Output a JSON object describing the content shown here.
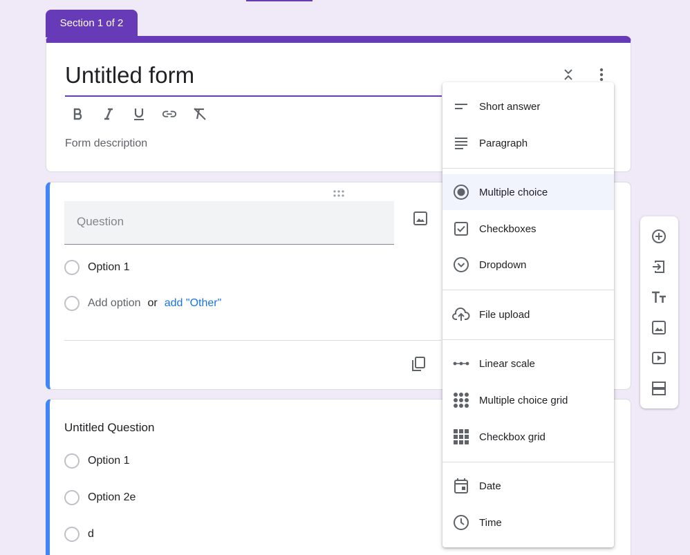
{
  "section_tab": "Section 1 of 2",
  "form": {
    "title": "Untitled form",
    "description_placeholder": "Form description"
  },
  "question1": {
    "placeholder": "Question",
    "options": [
      "Option 1"
    ],
    "add_option": "Add option",
    "or": "or",
    "add_other": "add \"Other\""
  },
  "question2": {
    "title": "Untitled Question",
    "options": [
      "Option 1",
      "Option 2e",
      "d"
    ]
  },
  "menu": {
    "items": [
      {
        "label": "Short answer",
        "icon": "short-answer-icon"
      },
      {
        "label": "Paragraph",
        "icon": "paragraph-icon"
      },
      {
        "label": "Multiple choice",
        "icon": "radio-icon",
        "active": true
      },
      {
        "label": "Checkboxes",
        "icon": "checkbox-icon"
      },
      {
        "label": "Dropdown",
        "icon": "dropdown-icon"
      },
      {
        "label": "File upload",
        "icon": "upload-icon"
      },
      {
        "label": "Linear scale",
        "icon": "linear-scale-icon"
      },
      {
        "label": "Multiple choice grid",
        "icon": "mc-grid-icon"
      },
      {
        "label": "Checkbox grid",
        "icon": "checkbox-grid-icon"
      },
      {
        "label": "Date",
        "icon": "date-icon"
      },
      {
        "label": "Time",
        "icon": "time-icon"
      }
    ]
  },
  "colors": {
    "accent": "#673ab7",
    "question_border": "#4285f4",
    "link": "#1a73e8",
    "background": "#efe9f8"
  }
}
